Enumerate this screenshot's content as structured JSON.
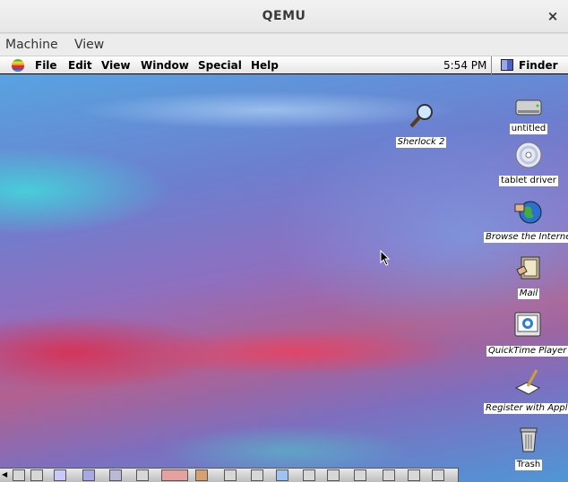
{
  "window": {
    "title": "QEMU",
    "close_glyph": "×",
    "menus": [
      "Machine",
      "View"
    ]
  },
  "mac_menubar": {
    "items": [
      "File",
      "Edit",
      "View",
      "Window",
      "Special",
      "Help"
    ],
    "clock": "5:54 PM",
    "app": "Finder"
  },
  "desktop_icons": [
    {
      "label": "Sherlock 2",
      "icon": "magnifier-icon",
      "alias": true
    },
    {
      "label": "untitled",
      "icon": "hard-disk-icon",
      "alias": false
    },
    {
      "label": "tablet driver",
      "icon": "cd-icon",
      "alias": false
    },
    {
      "label": "Browse the Interne",
      "icon": "globe-icon",
      "alias": true
    },
    {
      "label": "Mail",
      "icon": "mail-icon",
      "alias": true
    },
    {
      "label": "QuickTime Player",
      "icon": "quicktime-icon",
      "alias": true
    },
    {
      "label": "Register with Appl",
      "icon": "register-icon",
      "alias": true
    },
    {
      "label": "Trash",
      "icon": "trash-icon",
      "alias": false
    }
  ],
  "colors": {
    "menubar_bg": "#ececec",
    "mac_menubar_bg": "#ffffff",
    "label_bg": "#ffffff"
  }
}
